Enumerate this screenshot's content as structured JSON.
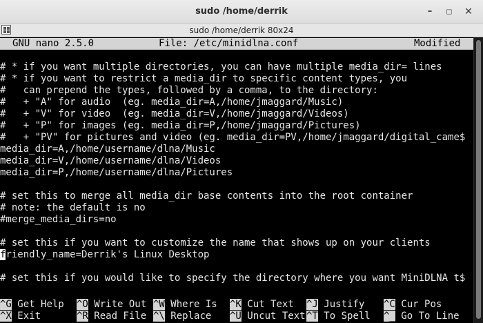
{
  "window": {
    "title": "sudo /home/derrik",
    "minimize_glyph": "–",
    "maximize_glyph": "◻",
    "close_glyph": "✕"
  },
  "terminal_bar": {
    "title": "sudo  /home/derrik 80x24",
    "menu_icon": "grid-menu-icon"
  },
  "nano": {
    "version": "GNU nano 2.5.0",
    "filename": "File: /etc/minidlna.conf",
    "status": "Modified"
  },
  "lines": [
    "# * if you want multiple directories, you can have multiple media_dir= lines",
    "# * if you want to restrict a media_dir to specific content types, you",
    "#   can prepend the types, followed by a comma, to the directory:",
    "#   + \"A\" for audio  (eg. media_dir=A,/home/jmaggard/Music)",
    "#   + \"V\" for video  (eg. media_dir=V,/home/jmaggard/Videos)",
    "#   + \"P\" for images (eg. media_dir=P,/home/jmaggard/Pictures)",
    "#   + \"PV\" for pictures and video (eg. media_dir=PV,/home/jmaggard/digital_came$",
    "media_dir=A,/home/username/dlna/Music",
    "media_dir=V,/home/username/dlna/Videos",
    "media_dir=P,/home/username/dlna/Pictures",
    "",
    "# set this to merge all media_dir base contents into the root container",
    "# note: the default is no",
    "#merge_media_dirs=no",
    "",
    "# set this if you want to customize the name that shows up on your clients",
    "",
    "",
    "# set this if you would like to specify the directory where you want MiniDLNA t$"
  ],
  "cursor_line": {
    "cursor_char": "f",
    "rest": "riendly_name=Derrik's Linux Desktop"
  },
  "shortcuts": {
    "row1": [
      {
        "key": "^G",
        "label": "Get Help"
      },
      {
        "key": "^O",
        "label": "Write Out"
      },
      {
        "key": "^W",
        "label": "Where Is"
      },
      {
        "key": "^K",
        "label": "Cut Text"
      },
      {
        "key": "^J",
        "label": "Justify"
      },
      {
        "key": "^C",
        "label": "Cur Pos"
      }
    ],
    "row2": [
      {
        "key": "^X",
        "label": "Exit"
      },
      {
        "key": "^R",
        "label": "Read File"
      },
      {
        "key": "^\\",
        "label": "Replace"
      },
      {
        "key": "^U",
        "label": "Uncut Text"
      },
      {
        "key": "^T",
        "label": "To Spell"
      },
      {
        "key": "^_",
        "label": "Go To Line"
      }
    ]
  },
  "colors": {
    "terminal_bg": "#000000",
    "terminal_fg": "#e6e6e6",
    "reverse_bg": "#d4d4d4"
  }
}
